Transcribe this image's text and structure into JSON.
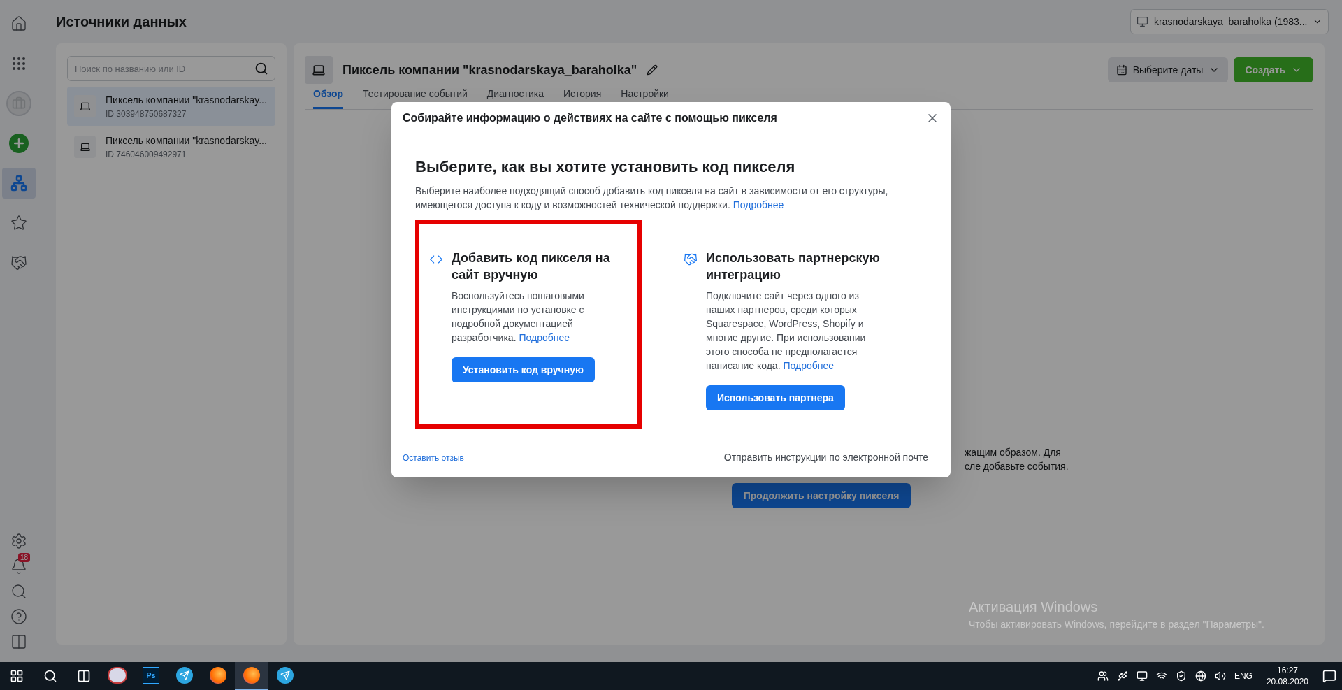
{
  "nav_rail": {
    "top_items": [
      {
        "kind": "home",
        "selected": false
      },
      {
        "kind": "apps",
        "selected": false
      },
      {
        "kind": "account",
        "selected": false
      },
      {
        "kind": "create",
        "selected": false
      },
      {
        "kind": "data_sources",
        "selected": true
      },
      {
        "kind": "star",
        "selected": false
      },
      {
        "kind": "partners",
        "selected": false
      }
    ],
    "bottom_items": [
      {
        "kind": "settings"
      },
      {
        "kind": "notifications",
        "badge": "18"
      },
      {
        "kind": "search"
      },
      {
        "kind": "help"
      },
      {
        "kind": "panel"
      }
    ]
  },
  "page": {
    "title": "Источники данных",
    "account_selector": "krasnodarskaya_baraholka (1983..."
  },
  "sources_list": {
    "search": {
      "placeholder": "Поиск по названию или ID"
    },
    "items": [
      {
        "name": "Пиксель компании \"krasnodarskay...",
        "id": "ID 303948750687327",
        "selected": true
      },
      {
        "name": "Пиксель компании \"krasnodarskay...",
        "id": "ID 746046009492971",
        "selected": false
      }
    ]
  },
  "pixel_panel": {
    "title": "Пиксель компании \"krasnodarskaya_baraholka\"",
    "date_button": "Выберите даты",
    "create_button": "Создать",
    "tabs": [
      {
        "label": "Обзор",
        "selected": true
      },
      {
        "label": "Тестирование событий",
        "selected": false
      },
      {
        "label": "Диагностика",
        "selected": false
      },
      {
        "label": "История",
        "selected": false
      },
      {
        "label": "Настройки",
        "selected": false
      }
    ],
    "body_lines": [
      "жащим образом. Для",
      "сле добавьте события."
    ],
    "continue_button": "Продолжить настройку пикселя"
  },
  "modal": {
    "title": "Собирайте информацию о действиях на сайте с помощью пикселя",
    "heading": "Выберите, как вы хотите установить код пикселя",
    "description": "Выберите наиболее подходящий способ добавить код пикселя на сайт в зависимости от его структуры, имеющегося доступа к коду и возможностей технической поддержки.",
    "description_link": "Подробнее",
    "options": [
      {
        "kind": "manual",
        "title": "Добавить код пикселя на сайт вручную",
        "text": "Воспользуйтесь пошаговыми инструкциями по установке с подробной документацией разработчика.",
        "link": "Подробнее",
        "button": "Установить код вручную",
        "highlighted": true
      },
      {
        "kind": "partner",
        "title": "Использовать партнерскую интеграцию",
        "text": "Подключите сайт через одного из наших партнеров, среди которых Squarespace, WordPress, Shopify и многие другие. При использовании этого способа не предполагается написание кода.",
        "link": "Подробнее",
        "button": "Использовать партнера",
        "highlighted": false
      }
    ],
    "feedback_link": "Оставить отзыв",
    "email_link": "Отправить инструкции по электронной почте"
  },
  "os_notice": {
    "title": "Активация Windows",
    "text": "Чтобы активировать Windows, перейдите в раздел \"Параметры\"."
  },
  "taskbar": {
    "apps": [
      {
        "kind": "app",
        "active": false
      },
      {
        "kind": "photoshop",
        "label": "Ps",
        "active": false
      },
      {
        "kind": "telegram",
        "active": false
      },
      {
        "kind": "firefox",
        "active": false
      },
      {
        "kind": "firefox",
        "active": true
      },
      {
        "kind": "telegram",
        "active": false
      }
    ],
    "language": "ENG",
    "time": "16:27",
    "date": "20.08.2020"
  }
}
